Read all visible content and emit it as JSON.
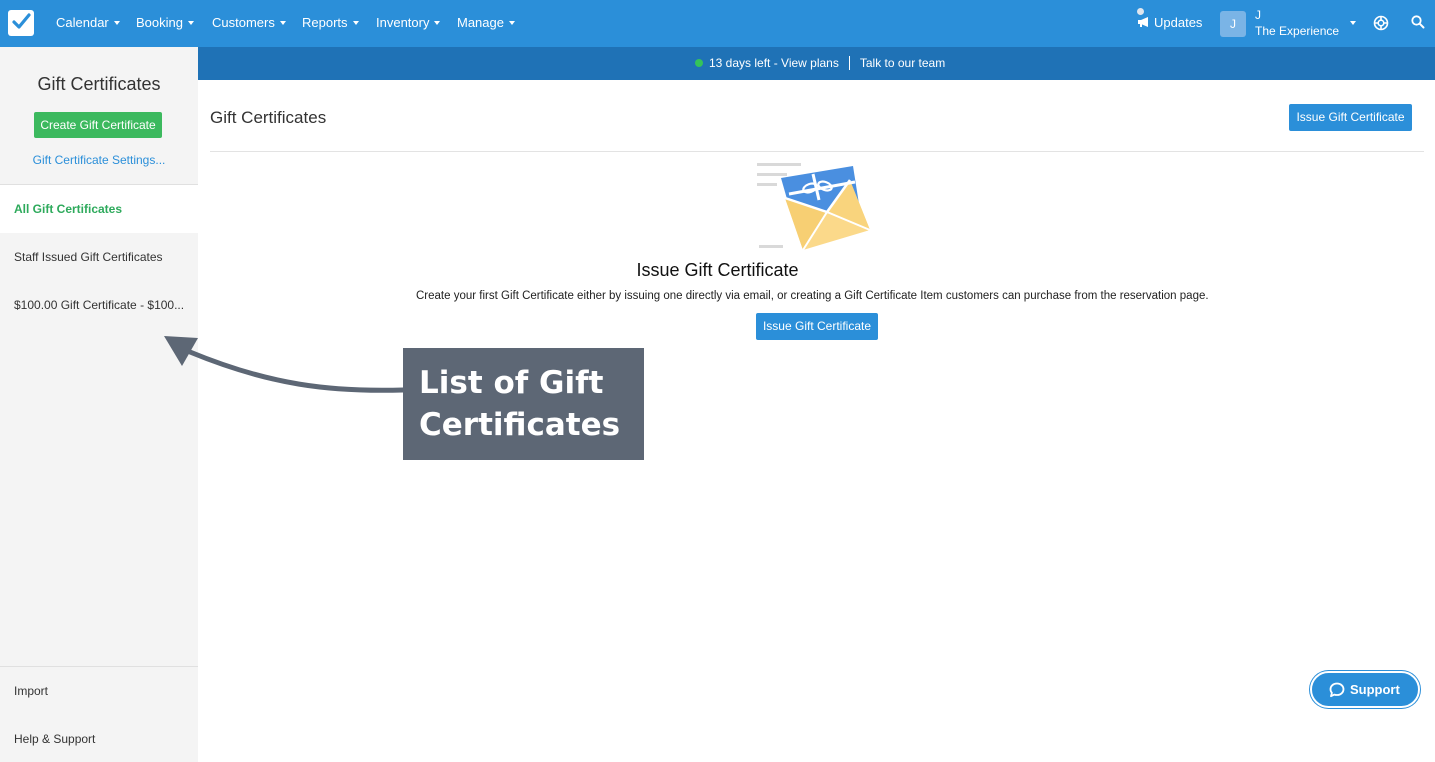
{
  "nav": {
    "items": [
      {
        "label": "Calendar"
      },
      {
        "label": "Booking"
      },
      {
        "label": "Customers"
      },
      {
        "label": "Reports"
      },
      {
        "label": "Inventory"
      },
      {
        "label": "Manage"
      }
    ],
    "updates_label": "Updates",
    "avatar_initial": "J",
    "account_name": "J",
    "account_business": "The Experience"
  },
  "banner": {
    "trial_text": "13 days left - View plans",
    "contact_text": "Talk to our team"
  },
  "sidebar": {
    "title": "Gift Certificates",
    "create_button": "Create Gift Certificate",
    "settings_link": "Gift Certificate Settings...",
    "items": [
      {
        "label": "All Gift Certificates",
        "active": true
      },
      {
        "label": "Staff Issued Gift Certificates"
      },
      {
        "label": "$100.00 Gift Certificate - $100..."
      }
    ],
    "footer": [
      {
        "label": "Import"
      },
      {
        "label": "Help & Support"
      }
    ]
  },
  "main": {
    "title": "Gift Certificates",
    "issue_button": "Issue Gift Certificate",
    "empty_title": "Issue Gift Certificate",
    "empty_description": "Create your first Gift Certificate either by issuing one directly via email, or creating a Gift Certificate Item customers can purchase from the reservation page.",
    "empty_button": "Issue Gift Certificate"
  },
  "annotation": {
    "line1": "List of Gift",
    "line2": "Certificates"
  },
  "support": {
    "label": "Support"
  },
  "colors": {
    "nav_bg": "#2b8fd9",
    "banner_bg": "#1f72b6",
    "primary": "#2b8fd9",
    "success": "#3cb95e",
    "active_text": "#2eaa5c",
    "callout_bg": "#5d6775"
  }
}
